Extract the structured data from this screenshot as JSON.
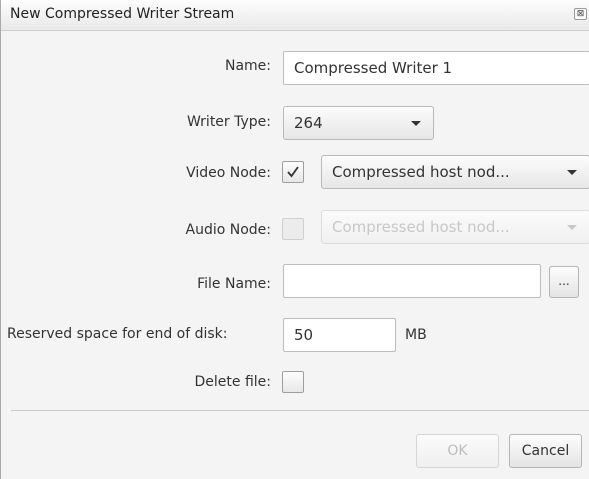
{
  "dialog": {
    "title": "New Compressed Writer Stream",
    "close_glyph": "⊠",
    "close_icon": "close-icon"
  },
  "form": {
    "name_label": "Name:",
    "name_value": "Compressed Writer 1",
    "writer_type_label": "Writer Type:",
    "writer_type_value": "264",
    "video_node_label": "Video Node:",
    "video_node_checked": true,
    "video_node_value": "Compressed host nod...",
    "audio_node_label": "Audio Node:",
    "audio_node_checked": false,
    "audio_node_value": "Compressed host nod...",
    "file_name_label": "File Name:",
    "file_name_value": "",
    "browse_label": "...",
    "reserved_label": "Reserved space for end of disk:",
    "reserved_value": "50",
    "reserved_unit": "MB",
    "delete_file_label": "Delete file:",
    "delete_file_checked": false
  },
  "buttons": {
    "ok_label": "OK",
    "cancel_label": "Cancel"
  }
}
